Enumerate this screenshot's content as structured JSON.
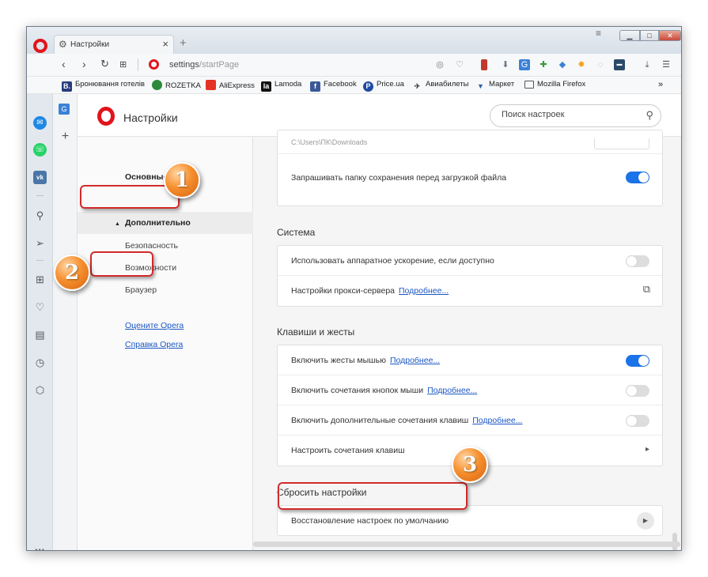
{
  "browser": {
    "tab_title": "Настройки",
    "url_host": "settings",
    "url_path": "/startPage"
  },
  "bookmarks": [
    {
      "label": "Бронювання готелів",
      "icon": "booking-icon",
      "color": "#273b7d",
      "glyph": "B."
    },
    {
      "label": "ROZETKA",
      "icon": "rozetka-icon",
      "color": "#2a8a3a",
      "glyph": ""
    },
    {
      "label": "AliExpress",
      "icon": "aliexpress-icon",
      "color": "#e43225",
      "glyph": ""
    },
    {
      "label": "Lamoda",
      "icon": "lamoda-icon",
      "color": "#111111",
      "glyph": "la"
    },
    {
      "label": "Facebook",
      "icon": "facebook-icon",
      "color": "#3b5998",
      "glyph": "f"
    },
    {
      "label": "Price.ua",
      "icon": "priceua-icon",
      "color": "#1e4aa0",
      "glyph": "P"
    },
    {
      "label": "Авиабилеты",
      "icon": "plane-icon",
      "color": "#444444",
      "glyph": "✈"
    },
    {
      "label": "Маркет",
      "icon": "cart-icon",
      "color": "#2f5fa8",
      "glyph": "🛒"
    },
    {
      "label": "Mozilla Firefox",
      "icon": "folder-icon",
      "color": "#555555",
      "glyph": "▭"
    }
  ],
  "settings": {
    "title": "Настройки",
    "search_placeholder": "Поиск настроек",
    "nav": {
      "basic": "Основные",
      "advanced": "Дополнительно",
      "security": "Безопасность",
      "features": "Возможности",
      "browser": "Браузер",
      "rate": "Оцените Opera",
      "help": "Справка Opera"
    },
    "download_path": "C:\\Users\\ПК\\Downloads",
    "ask_download": "Запрашивать папку сохранения перед загрузкой файла",
    "system": {
      "heading": "Система",
      "hw_accel": "Использовать аппаратное ускорение, если доступно",
      "proxy": "Настройки прокси-сервера",
      "proxy_more": "Подробнее..."
    },
    "keys": {
      "heading": "Клавиши и жесты",
      "mouse_gestures": "Включить жесты мышью",
      "mouse_gestures_more": "Подробнее...",
      "rocker": "Включить сочетания кнопок мыши",
      "rocker_more": "Подробнее...",
      "advanced_keys": "Включить дополнительные сочетания клавиш",
      "advanced_keys_more": "Подробнее...",
      "configure": "Настроить сочетания клавиш"
    },
    "reset": {
      "heading": "Сбросить настройки",
      "restore": "Восстановление настроек по умолчанию"
    },
    "toggles": {
      "ask_download": true,
      "hw_accel": false,
      "mouse_gestures": true,
      "rocker": false,
      "advanced_keys": false
    }
  },
  "annotations": {
    "n1": "1",
    "n2": "2",
    "n3": "3"
  },
  "colors": {
    "opera_red": "#e1141b",
    "accent": "#1a73e8",
    "badge": "#f6902f",
    "highlight": "#d12a2a"
  }
}
